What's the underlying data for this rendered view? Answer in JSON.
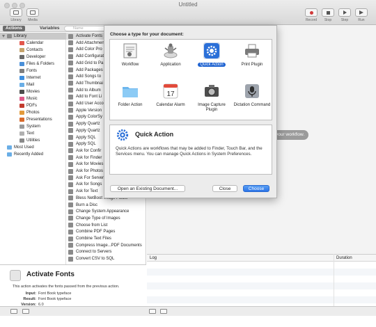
{
  "window": {
    "title": "Untitled",
    "toolbar_left": [
      {
        "label": "Library"
      },
      {
        "label": "Media"
      }
    ],
    "toolbar_right": [
      {
        "label": "Record"
      },
      {
        "label": "Stop"
      },
      {
        "label": "Step"
      },
      {
        "label": "Run"
      }
    ]
  },
  "library": {
    "tabs": [
      "Actions",
      "Variables"
    ],
    "search_placeholder": "Name",
    "categories": [
      {
        "label": "Library",
        "level": 0,
        "selected": true
      },
      {
        "label": "Calendar",
        "level": 1
      },
      {
        "label": "Contacts",
        "level": 1
      },
      {
        "label": "Developer",
        "level": 1
      },
      {
        "label": "Files & Folders",
        "level": 1
      },
      {
        "label": "Fonts",
        "level": 1
      },
      {
        "label": "Internet",
        "level": 1
      },
      {
        "label": "Mail",
        "level": 1
      },
      {
        "label": "Movies",
        "level": 1
      },
      {
        "label": "Music",
        "level": 1
      },
      {
        "label": "PDFs",
        "level": 1
      },
      {
        "label": "Photos",
        "level": 1
      },
      {
        "label": "Presentations",
        "level": 1
      },
      {
        "label": "System",
        "level": 1
      },
      {
        "label": "Text",
        "level": 1
      },
      {
        "label": "Utilities",
        "level": 1
      },
      {
        "label": "Most Used",
        "level": 0
      },
      {
        "label": "Recently Added",
        "level": 0
      }
    ],
    "actions": [
      "Activate Fonts",
      "Add Attachments",
      "Add Color Pro",
      "Add Configurat",
      "Add Grid to Pa",
      "Add Packages",
      "Add Songs to",
      "Add Thumbnai",
      "Add to Album",
      "Add to Font Li",
      "Add User Acco",
      "Apple Version",
      "Apply ColorSy",
      "Apply Quartz",
      "Apply Quartz",
      "Apply SQL",
      "Apply SQL",
      "Ask for Confir",
      "Ask for Finder",
      "Ask for Movies",
      "Ask for Photos",
      "Ask For Servers",
      "Ask for Songs",
      "Ask for Text",
      "Bless NetBoot Image Folder",
      "Burn a Disc",
      "Change System Appearance",
      "Change Type of Images",
      "Choose from List",
      "Combine PDF Pages",
      "Combine Text Files",
      "Compress Image...PDF Documents",
      "Connect to Servers",
      "Convert CSV to SQL"
    ]
  },
  "description": {
    "title": "Activate Fonts",
    "text": "This action activates the fonts passed from the previous action.",
    "input_label": "Input:",
    "input_value": "Font Book typeface",
    "result_label": "Result:",
    "result_value": "Font Book typeface",
    "version_label": "Version:",
    "version_value": "6.0"
  },
  "workflow": {
    "hint": "r your workflow."
  },
  "log": {
    "col_log": "Log",
    "col_duration": "Duration"
  },
  "dialog": {
    "title": "Choose a type for your document:",
    "types": [
      {
        "label": "Workflow",
        "icon": "workflow-robot-icon"
      },
      {
        "label": "Application",
        "icon": "application-robot-icon"
      },
      {
        "label": "Quick Action",
        "icon": "gear-icon",
        "selected": true
      },
      {
        "label": "Print Plugin",
        "icon": "printer-icon"
      },
      {
        "label": "Folder Action",
        "icon": "folder-icon"
      },
      {
        "label": "Calendar Alarm",
        "icon": "calendar-icon",
        "day": "17"
      },
      {
        "label": "Image Capture Plugin",
        "icon": "camera-icon"
      },
      {
        "label": "Dictation Command",
        "icon": "microphone-icon"
      }
    ],
    "info_title": "Quick Action",
    "info_text": "Quick Actions are workflows that may be added to Finder, Touch Bar, and the Services menu. You can manage Quick Actions in System Preferences.",
    "open_existing": "Open an Existing Document...",
    "close": "Close",
    "choose": "Choose"
  },
  "colors": {
    "accent": "#1f63d1",
    "choose_button": "#2b74e8",
    "record": "#d03a3a"
  }
}
